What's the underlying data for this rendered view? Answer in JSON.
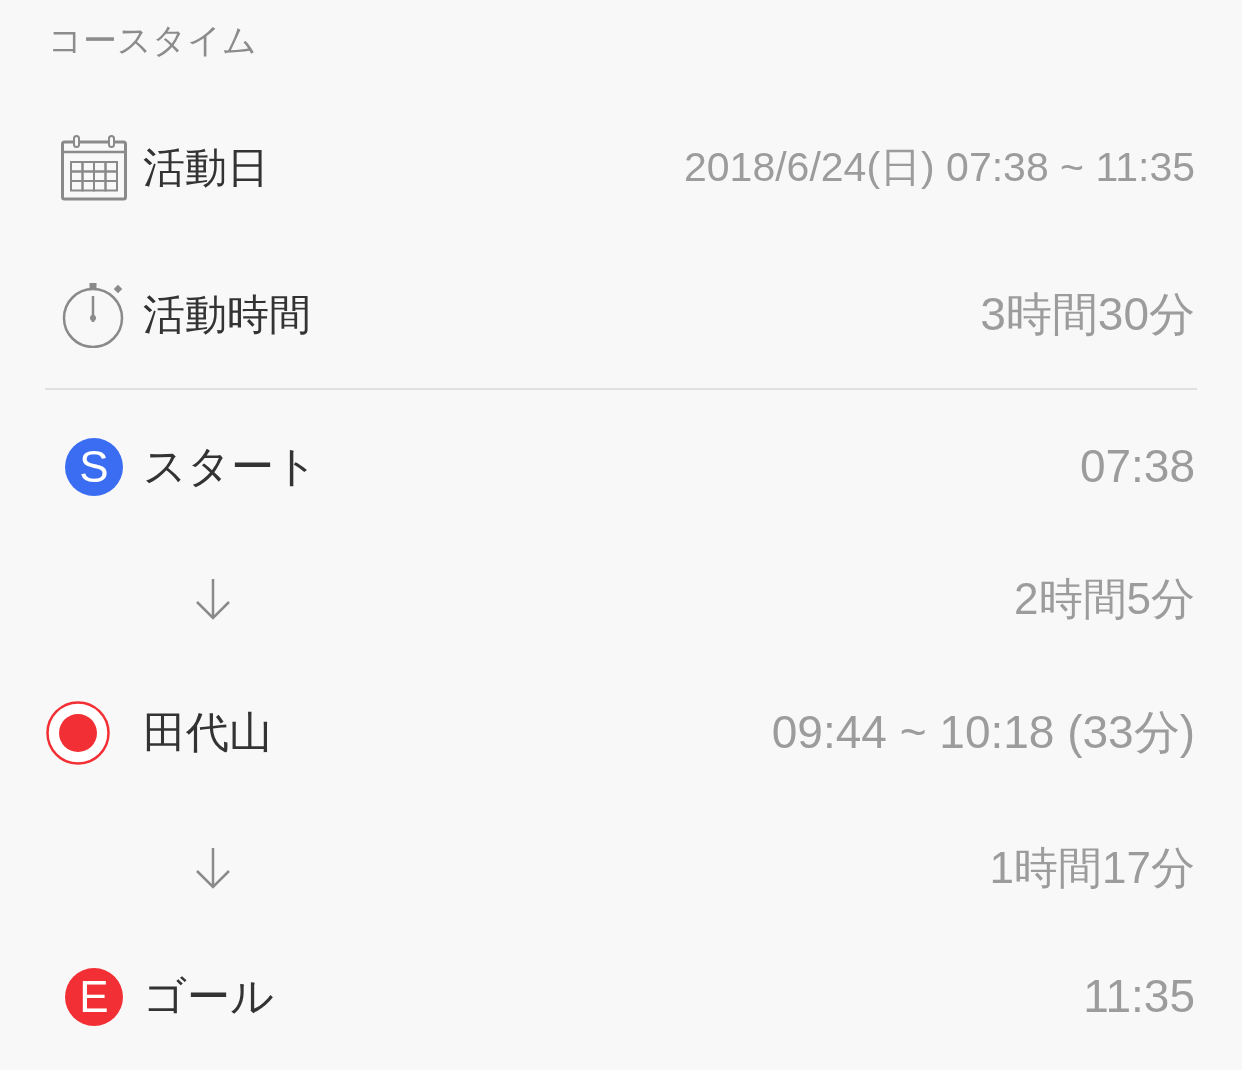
{
  "section_title": "コースタイム",
  "summary": [
    {
      "kind": "date",
      "label": "活動日",
      "value": "2018/6/24(日) 07:38 ~ 11:35"
    },
    {
      "kind": "duration",
      "label": "活動時間",
      "value": "3時間30分"
    }
  ],
  "route": [
    {
      "kind": "start",
      "badge": "S",
      "label": "スタート",
      "time": "07:38",
      "color": "#3a6df2"
    },
    {
      "kind": "leg",
      "duration": "2時間5分"
    },
    {
      "kind": "waypoint",
      "label": "田代山",
      "time": "09:44 ~ 10:18 (33分)",
      "color": "#f22f35"
    },
    {
      "kind": "leg",
      "duration": "1時間17分"
    },
    {
      "kind": "goal",
      "badge": "E",
      "label": "ゴール",
      "time": "11:35",
      "color": "#f22f35"
    }
  ]
}
